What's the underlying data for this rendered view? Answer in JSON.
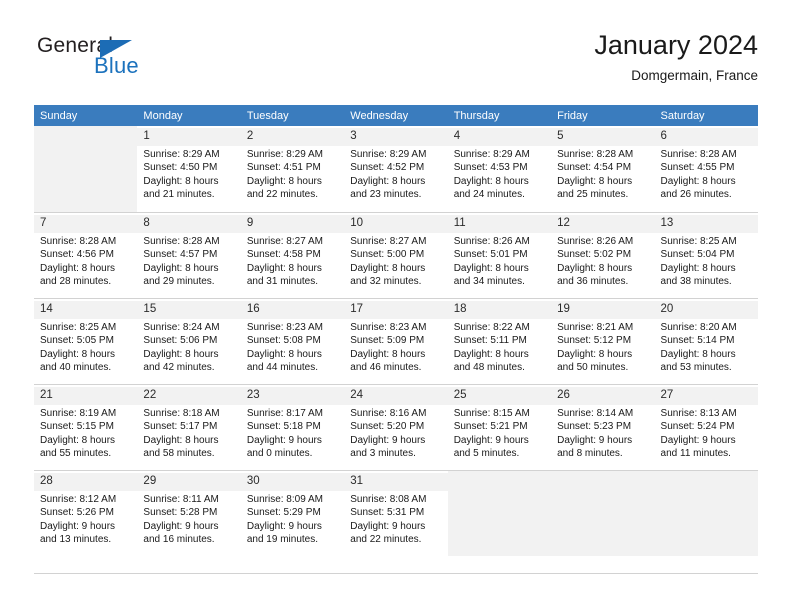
{
  "brand": {
    "name_part1": "General",
    "name_part2": "Blue",
    "triangle_color": "#1c6cb5",
    "blue_text_color": "#1c72bd"
  },
  "header": {
    "title": "January 2024",
    "subtitle": "Domgermain, France"
  },
  "theme": {
    "header_row_bg": "#3a7cbe",
    "header_row_text": "#ffffff",
    "daynum_bg": "#f2f2f2",
    "grid_line": "#d2d2d2"
  },
  "weekdays": [
    "Sunday",
    "Monday",
    "Tuesday",
    "Wednesday",
    "Thursday",
    "Friday",
    "Saturday"
  ],
  "weeks": [
    [
      {
        "day": "",
        "info": ""
      },
      {
        "day": "1",
        "info": "Sunrise: 8:29 AM\nSunset: 4:50 PM\nDaylight: 8 hours\nand 21 minutes."
      },
      {
        "day": "2",
        "info": "Sunrise: 8:29 AM\nSunset: 4:51 PM\nDaylight: 8 hours\nand 22 minutes."
      },
      {
        "day": "3",
        "info": "Sunrise: 8:29 AM\nSunset: 4:52 PM\nDaylight: 8 hours\nand 23 minutes."
      },
      {
        "day": "4",
        "info": "Sunrise: 8:29 AM\nSunset: 4:53 PM\nDaylight: 8 hours\nand 24 minutes."
      },
      {
        "day": "5",
        "info": "Sunrise: 8:28 AM\nSunset: 4:54 PM\nDaylight: 8 hours\nand 25 minutes."
      },
      {
        "day": "6",
        "info": "Sunrise: 8:28 AM\nSunset: 4:55 PM\nDaylight: 8 hours\nand 26 minutes."
      }
    ],
    [
      {
        "day": "7",
        "info": "Sunrise: 8:28 AM\nSunset: 4:56 PM\nDaylight: 8 hours\nand 28 minutes."
      },
      {
        "day": "8",
        "info": "Sunrise: 8:28 AM\nSunset: 4:57 PM\nDaylight: 8 hours\nand 29 minutes."
      },
      {
        "day": "9",
        "info": "Sunrise: 8:27 AM\nSunset: 4:58 PM\nDaylight: 8 hours\nand 31 minutes."
      },
      {
        "day": "10",
        "info": "Sunrise: 8:27 AM\nSunset: 5:00 PM\nDaylight: 8 hours\nand 32 minutes."
      },
      {
        "day": "11",
        "info": "Sunrise: 8:26 AM\nSunset: 5:01 PM\nDaylight: 8 hours\nand 34 minutes."
      },
      {
        "day": "12",
        "info": "Sunrise: 8:26 AM\nSunset: 5:02 PM\nDaylight: 8 hours\nand 36 minutes."
      },
      {
        "day": "13",
        "info": "Sunrise: 8:25 AM\nSunset: 5:04 PM\nDaylight: 8 hours\nand 38 minutes."
      }
    ],
    [
      {
        "day": "14",
        "info": "Sunrise: 8:25 AM\nSunset: 5:05 PM\nDaylight: 8 hours\nand 40 minutes."
      },
      {
        "day": "15",
        "info": "Sunrise: 8:24 AM\nSunset: 5:06 PM\nDaylight: 8 hours\nand 42 minutes."
      },
      {
        "day": "16",
        "info": "Sunrise: 8:23 AM\nSunset: 5:08 PM\nDaylight: 8 hours\nand 44 minutes."
      },
      {
        "day": "17",
        "info": "Sunrise: 8:23 AM\nSunset: 5:09 PM\nDaylight: 8 hours\nand 46 minutes."
      },
      {
        "day": "18",
        "info": "Sunrise: 8:22 AM\nSunset: 5:11 PM\nDaylight: 8 hours\nand 48 minutes."
      },
      {
        "day": "19",
        "info": "Sunrise: 8:21 AM\nSunset: 5:12 PM\nDaylight: 8 hours\nand 50 minutes."
      },
      {
        "day": "20",
        "info": "Sunrise: 8:20 AM\nSunset: 5:14 PM\nDaylight: 8 hours\nand 53 minutes."
      }
    ],
    [
      {
        "day": "21",
        "info": "Sunrise: 8:19 AM\nSunset: 5:15 PM\nDaylight: 8 hours\nand 55 minutes."
      },
      {
        "day": "22",
        "info": "Sunrise: 8:18 AM\nSunset: 5:17 PM\nDaylight: 8 hours\nand 58 minutes."
      },
      {
        "day": "23",
        "info": "Sunrise: 8:17 AM\nSunset: 5:18 PM\nDaylight: 9 hours\nand 0 minutes."
      },
      {
        "day": "24",
        "info": "Sunrise: 8:16 AM\nSunset: 5:20 PM\nDaylight: 9 hours\nand 3 minutes."
      },
      {
        "day": "25",
        "info": "Sunrise: 8:15 AM\nSunset: 5:21 PM\nDaylight: 9 hours\nand 5 minutes."
      },
      {
        "day": "26",
        "info": "Sunrise: 8:14 AM\nSunset: 5:23 PM\nDaylight: 9 hours\nand 8 minutes."
      },
      {
        "day": "27",
        "info": "Sunrise: 8:13 AM\nSunset: 5:24 PM\nDaylight: 9 hours\nand 11 minutes."
      }
    ],
    [
      {
        "day": "28",
        "info": "Sunrise: 8:12 AM\nSunset: 5:26 PM\nDaylight: 9 hours\nand 13 minutes."
      },
      {
        "day": "29",
        "info": "Sunrise: 8:11 AM\nSunset: 5:28 PM\nDaylight: 9 hours\nand 16 minutes."
      },
      {
        "day": "30",
        "info": "Sunrise: 8:09 AM\nSunset: 5:29 PM\nDaylight: 9 hours\nand 19 minutes."
      },
      {
        "day": "31",
        "info": "Sunrise: 8:08 AM\nSunset: 5:31 PM\nDaylight: 9 hours\nand 22 minutes."
      },
      {
        "day": "",
        "info": ""
      },
      {
        "day": "",
        "info": ""
      },
      {
        "day": "",
        "info": ""
      }
    ]
  ]
}
